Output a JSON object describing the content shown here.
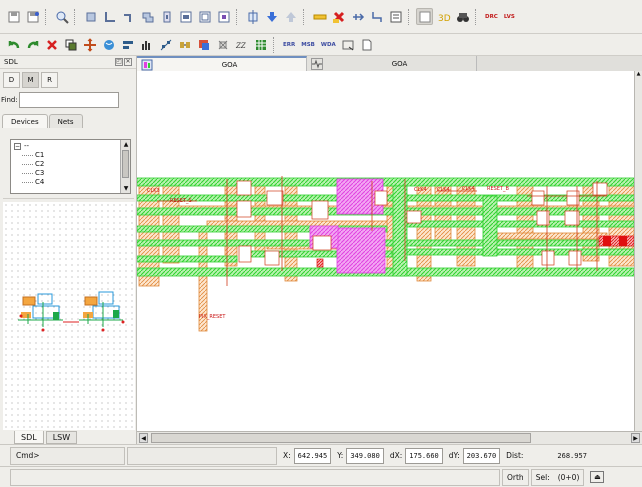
{
  "toolbar": {
    "row2_texts": {
      "err": "ERR",
      "msb": "MSB",
      "wda": "WDA"
    },
    "row1_texts": {
      "drc": "DRC",
      "lvs": "LVS"
    }
  },
  "dock": {
    "title": "SDL",
    "modes": [
      "D",
      "M",
      "R"
    ],
    "find_label": "Find:",
    "find_value": "",
    "tabs": [
      "Devices",
      "Nets"
    ],
    "tree_root": "--",
    "tree_items": [
      "C1",
      "C2",
      "C3",
      "C4"
    ],
    "bottom_tabs": [
      "SDL",
      "LSW"
    ]
  },
  "doc_tabs": [
    {
      "label": "GOA",
      "icon": "layout-view-icon"
    },
    {
      "label": "GOA",
      "icon": "schematic-view-icon"
    }
  ],
  "layout_labels": [
    "CLK3",
    "RESET_S",
    "CLK4",
    "CLK4",
    "CLK4",
    "RESET_B",
    "PIX_RESET"
  ],
  "status": {
    "cmd_label": "Cmd>",
    "x_label": "X:",
    "x_value": "642.945",
    "y_label": "Y:",
    "y_value": "349.080",
    "dx_label": "dX:",
    "dx_value": "175.660",
    "dy_label": "dY:",
    "dy_value": "203.670",
    "dist_label": "Dist:",
    "dist_value": "268.957",
    "mode": "Orth",
    "sel_label": "Sel:",
    "sel_value": "(0+0)"
  },
  "colors": {
    "metal_green": "#2fd12f",
    "poly_orange": "#e08a3c",
    "via_magenta": "#e040e0",
    "marker_red": "#e01010",
    "accent_blue": "#6f8fbf"
  }
}
